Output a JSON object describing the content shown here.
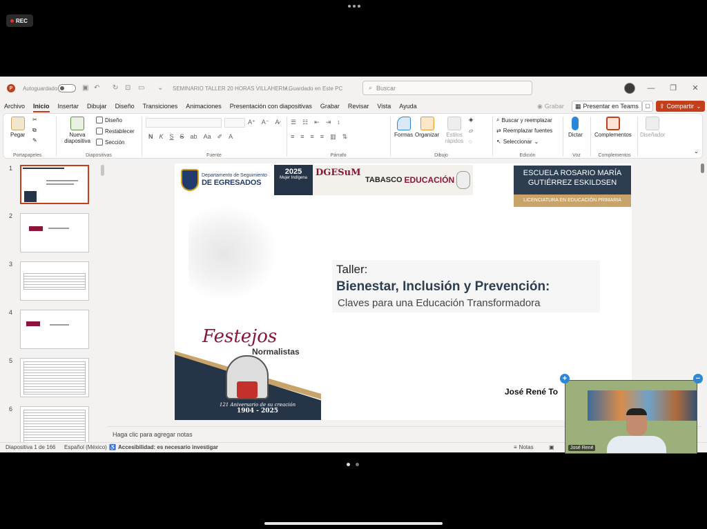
{
  "recording": {
    "label": "REC"
  },
  "titlebar": {
    "autosave_label": "Autoguardado",
    "doc_title": "SEMINARIO TALLER 20 HORAS VILLAHERM...",
    "save_state": "• Guardado en Este PC",
    "search_placeholder": "Buscar"
  },
  "menu": {
    "items": [
      "Archivo",
      "Inicio",
      "Insertar",
      "Dibujar",
      "Diseño",
      "Transiciones",
      "Animaciones",
      "Presentación con diapositivas",
      "Grabar",
      "Revisar",
      "Vista",
      "Ayuda"
    ],
    "active": "Inicio",
    "grabar_label": "Grabar",
    "teams_label": "Presentar en Teams",
    "share_label": "Compartir"
  },
  "ribbon": {
    "clipboard": {
      "paste": "Pegar",
      "label": "Portapapeles"
    },
    "slides": {
      "new_slide": "Nueva diapositiva",
      "design": "Diseño",
      "reset": "Restablecer",
      "section": "Sección",
      "label": "Diapositivas"
    },
    "font": {
      "label": "Fuente",
      "buttons": [
        "N",
        "K",
        "S",
        "S",
        "ab"
      ]
    },
    "paragraph": {
      "label": "Párrafo"
    },
    "drawing": {
      "shapes": "Formas",
      "arrange": "Organizar",
      "quick_styles": "Estilos rápidos",
      "label": "Dibujo"
    },
    "editing": {
      "find_replace": "Buscar y reemplazar",
      "replace_fonts": "Reemplazar fuentes",
      "select": "Seleccionar",
      "label": "Edición"
    },
    "voice": {
      "dictate": "Dictar",
      "label": "Voz"
    },
    "addins": {
      "addins": "Complementos",
      "label": "Complementos"
    },
    "designer": {
      "label": "Diseñador"
    }
  },
  "thumbnails": [
    {
      "num": "1"
    },
    {
      "num": "2"
    },
    {
      "num": "3"
    },
    {
      "num": "4"
    },
    {
      "num": "5"
    },
    {
      "num": "6"
    }
  ],
  "slide": {
    "seg_line1": "Departamento de Seguimiento",
    "seg_line2": "DE EGRESADOS",
    "mujer_year": "2025",
    "mujer_text": "Mujer Indígena",
    "dgesum": "DGESuM",
    "tabasco": "TABASCO",
    "educacion": "EDUCACIÓN",
    "escuela_line1": "ESCUELA ROSARIO MARÍA",
    "escuela_line2": "GUTIÉRREZ ESKILDSEN",
    "escuela_sub": "LICENCIATURA EN EDUCACIÓN PRIMARIA",
    "taller_label": "Taller:",
    "title": "Bienestar, Inclusión y Prevención:",
    "subtitle": "Claves para una Educación Transformadora",
    "festejos": "Festejos",
    "normalistas": "Normalistas",
    "aniversario": "121 Aniversario de su creación",
    "years": "1904 - 2025",
    "presenter": "José René To"
  },
  "notes": {
    "placeholder": "Haga clic para agregar notas"
  },
  "status": {
    "slide_count": "Diapositiva 1 de 166",
    "language": "Español (México)",
    "accessibility": "Accesibilidad: es necesario investigar",
    "notes_btn": "Notas"
  },
  "video": {
    "participant": "José René"
  },
  "colors": {
    "accent": "#c43e1c",
    "navy": "#2c3e50",
    "gold": "#c9a46a",
    "maroon": "#8a1538"
  }
}
